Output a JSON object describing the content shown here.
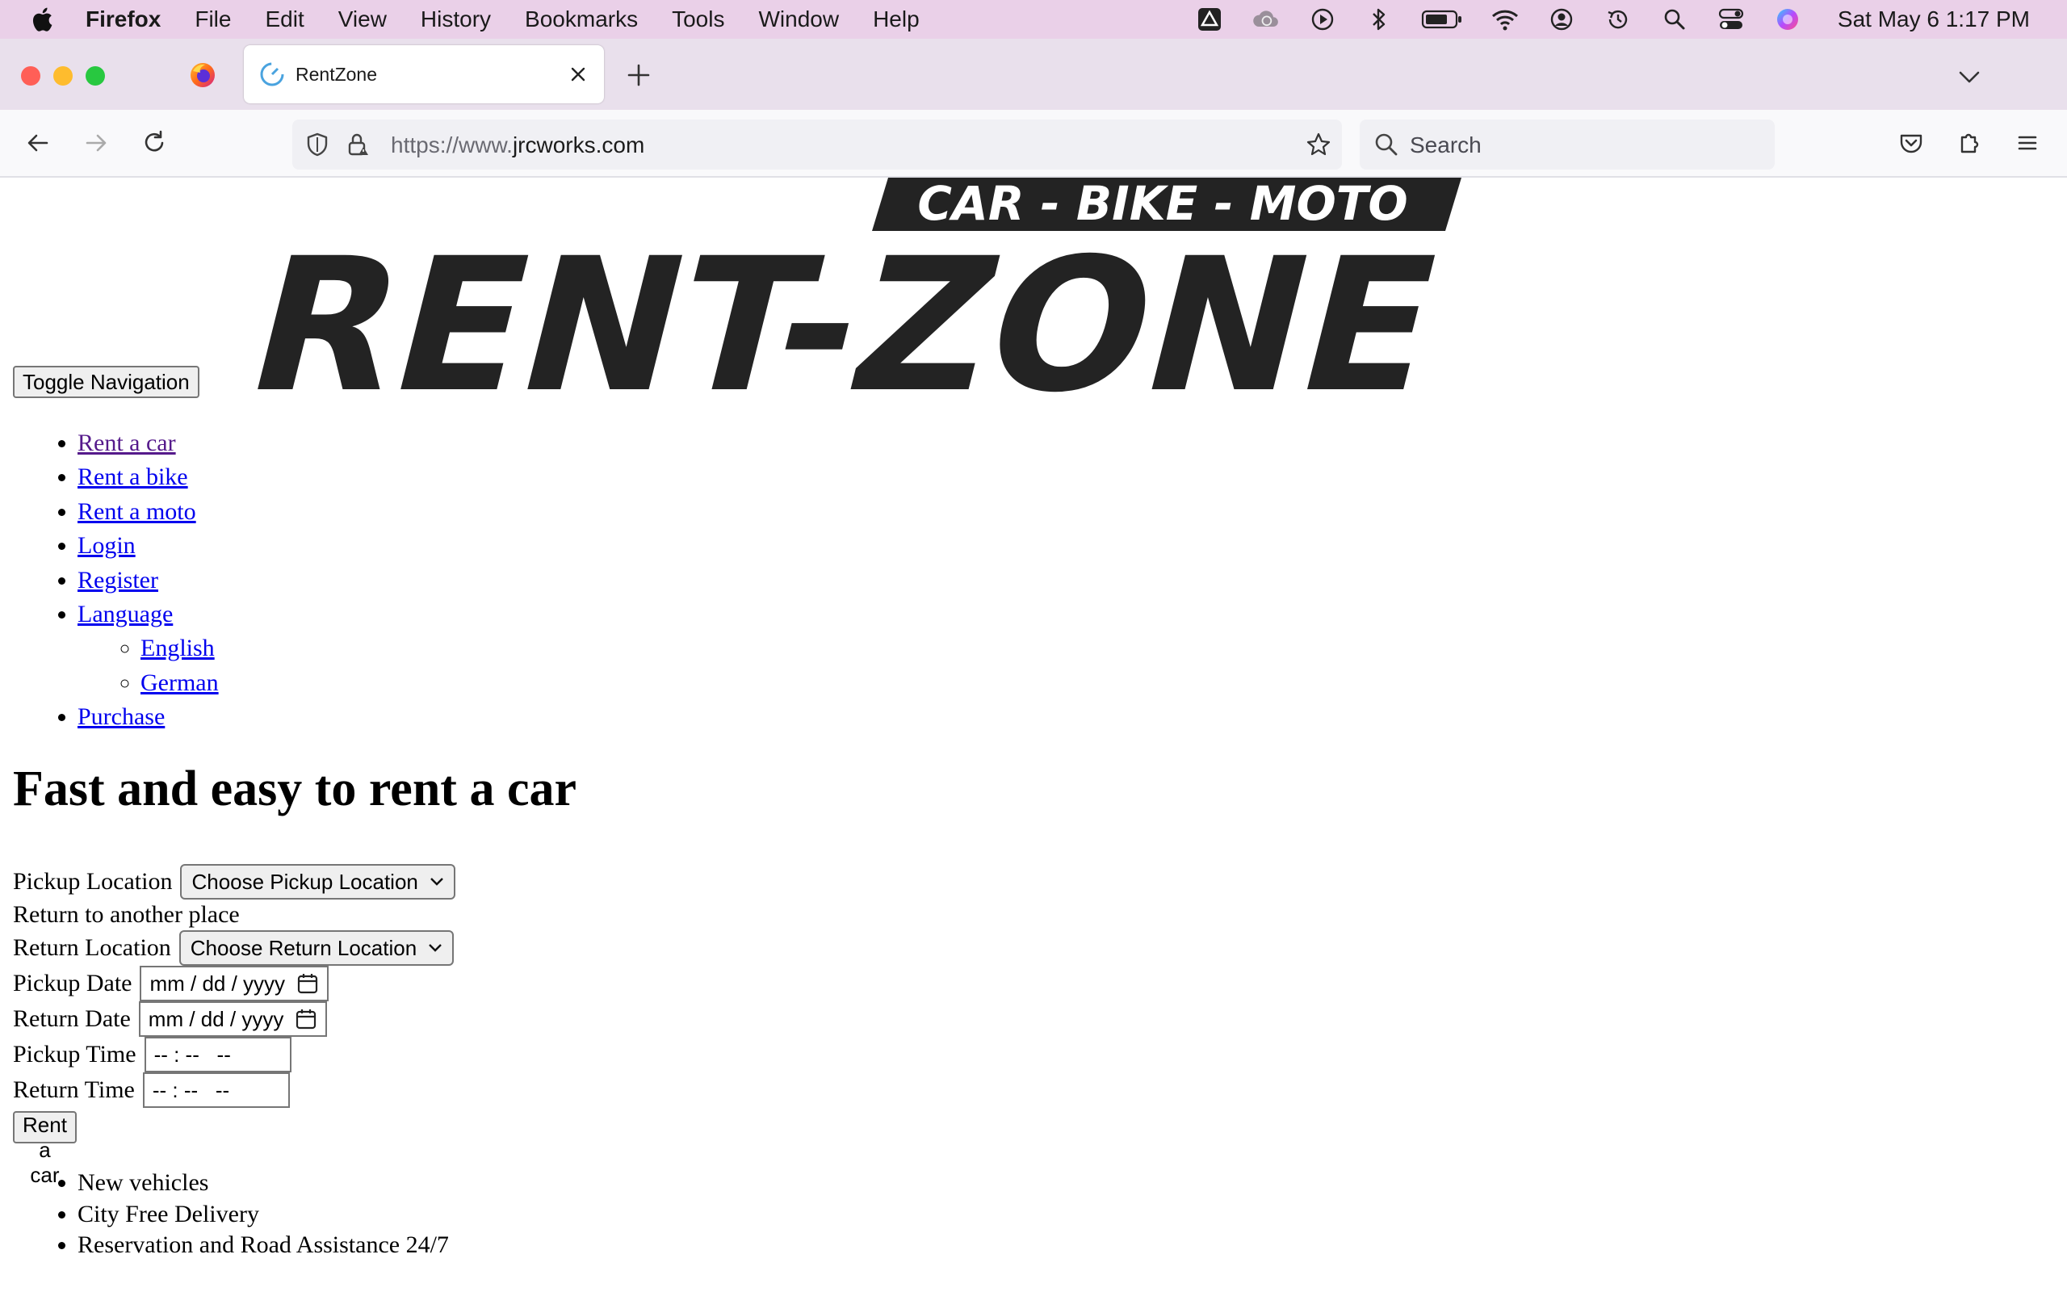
{
  "menubar": {
    "apple": "apple-icon",
    "app": "Firefox",
    "items": [
      "File",
      "Edit",
      "View",
      "History",
      "Bookmarks",
      "Tools",
      "Window",
      "Help"
    ],
    "clock": "Sat May 6  1:17 PM"
  },
  "browser": {
    "tab_title": "RentZone",
    "url_prefix": "https://www.",
    "url_domain": "jrcworks.com",
    "search_placeholder": "Search"
  },
  "page": {
    "toggle_label": "Toggle Navigation",
    "logo": {
      "tagline": "CAR - BIKE - MOTO",
      "name": "RENT-ZONE"
    },
    "nav": {
      "rent_car": "Rent a car",
      "rent_bike": "Rent a bike",
      "rent_moto": "Rent a moto",
      "login": "Login",
      "register": "Register",
      "language": "Language",
      "english": "English",
      "german": "German",
      "purchase": "Purchase"
    },
    "heading": "Fast and easy to rent a car",
    "form": {
      "pickup_location_label": "Pickup Location",
      "pickup_location_value": "Choose Pickup Location",
      "return_other": "Return to another place",
      "return_location_label": "Return Location",
      "return_location_value": "Choose Return Location",
      "pickup_date_label": "Pickup Date",
      "pickup_date_value": "mm / dd / yyyy",
      "return_date_label": "Return Date",
      "return_date_value": "mm / dd / yyyy",
      "pickup_time_label": "Pickup Time",
      "pickup_time_value": "-- : --   --",
      "return_time_label": "Return Time",
      "return_time_value": "-- : --   --",
      "submit": "Rent a car"
    },
    "features": [
      "New vehicles",
      "City Free Delivery",
      "Reservation and Road Assistance 24/7"
    ]
  }
}
